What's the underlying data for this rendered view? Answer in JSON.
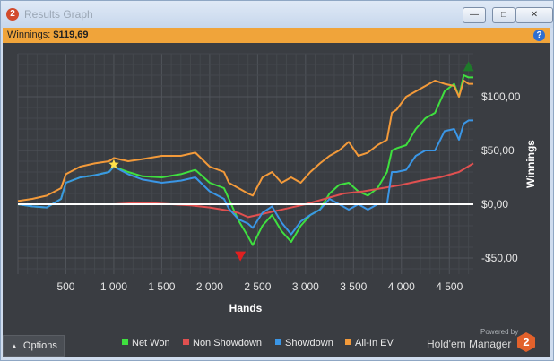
{
  "window": {
    "title": "Results Graph",
    "app_icon": "hm2-logo-icon",
    "controls": [
      "minimize-icon",
      "maximize-icon",
      "close-icon"
    ]
  },
  "winnings_bar": {
    "label": "Winnings:",
    "value": "$119,69",
    "help_icon": "help-icon"
  },
  "colors": {
    "net_won": "#3fe03f",
    "non_showdown": "#e05050",
    "showdown": "#3a96e6",
    "all_in_ev": "#f39a3a",
    "zero_line": "#ffffff",
    "plot_background": "#3a3d42",
    "grid": "#55595e"
  },
  "options": {
    "label": "Options",
    "icon": "caret-up-icon"
  },
  "branding": {
    "powered": "Powered by",
    "name": "Hold'em Manager",
    "logo": "hm2-logo-icon"
  },
  "chart_data": {
    "type": "line",
    "xlabel": "Hands",
    "ylabel": "Winnings",
    "xlim": [
      0,
      4750
    ],
    "ylim": [
      -65,
      140
    ],
    "x_ticks": [
      500,
      1000,
      1500,
      2000,
      2500,
      3000,
      3500,
      4000,
      4500
    ],
    "x_tick_labels": [
      "500",
      "1 000",
      "1 500",
      "2 000",
      "2 500",
      "3 000",
      "3 500",
      "4 000",
      "4 500"
    ],
    "y_ticks": [
      -50,
      0,
      50,
      100
    ],
    "y_tick_labels": [
      "-$50,00",
      "$0,00",
      "$50,00",
      "$100,00"
    ],
    "grid": true,
    "legend_position": "bottom",
    "markers": [
      {
        "type": "max-star",
        "series": "Net Won",
        "x": 1000,
        "y": 37
      },
      {
        "type": "min-triangle",
        "series": "Net Won",
        "x": 2320,
        "y": -48
      },
      {
        "type": "end-triangle",
        "series": "Net Won",
        "x": 4700,
        "y": 128
      }
    ],
    "series": [
      {
        "name": "Net Won",
        "color": "#3fe03f",
        "x": [
          0,
          150,
          300,
          450,
          500,
          650,
          800,
          950,
          1000,
          1150,
          1300,
          1500,
          1700,
          1850,
          2000,
          2150,
          2200,
          2300,
          2400,
          2450,
          2550,
          2650,
          2750,
          2850,
          2950,
          3050,
          3150,
          3250,
          3350,
          3450,
          3550,
          3650,
          3750,
          3850,
          3900,
          3950,
          4050,
          4150,
          4250,
          4350,
          4450,
          4550,
          4600,
          4650,
          4700,
          4750
        ],
        "y": [
          0,
          -2,
          -3,
          5,
          20,
          25,
          27,
          30,
          35,
          30,
          26,
          25,
          28,
          32,
          20,
          15,
          5,
          -15,
          -30,
          -38,
          -20,
          -10,
          -25,
          -35,
          -20,
          -10,
          -5,
          10,
          18,
          20,
          12,
          8,
          15,
          30,
          50,
          52,
          55,
          70,
          80,
          85,
          105,
          112,
          100,
          120,
          118,
          118
        ]
      },
      {
        "name": "Non Showdown",
        "color": "#e05050",
        "x": [
          0,
          200,
          400,
          600,
          800,
          1000,
          1200,
          1400,
          1600,
          1800,
          2000,
          2200,
          2300,
          2400,
          2600,
          2800,
          3000,
          3200,
          3400,
          3600,
          3800,
          4000,
          4200,
          4400,
          4600,
          4750
        ],
        "y": [
          0,
          0,
          0,
          0,
          0,
          0,
          1,
          1,
          0,
          -1,
          -3,
          -6,
          -8,
          -12,
          -8,
          -4,
          0,
          5,
          10,
          12,
          15,
          18,
          22,
          25,
          30,
          38
        ]
      },
      {
        "name": "Showdown",
        "color": "#3a96e6",
        "x": [
          0,
          150,
          300,
          450,
          500,
          650,
          800,
          950,
          1000,
          1150,
          1300,
          1500,
          1700,
          1850,
          2000,
          2150,
          2200,
          2300,
          2400,
          2450,
          2550,
          2650,
          2750,
          2850,
          2950,
          3050,
          3150,
          3250,
          3350,
          3450,
          3550,
          3650,
          3750,
          3850,
          3900,
          3950,
          4050,
          4150,
          4250,
          4350,
          4450,
          4550,
          4600,
          4650,
          4700,
          4750
        ],
        "y": [
          0,
          -2,
          -3,
          5,
          20,
          25,
          27,
          30,
          35,
          28,
          23,
          20,
          22,
          25,
          12,
          5,
          -4,
          -14,
          -18,
          -22,
          -8,
          -2,
          -17,
          -28,
          -16,
          -10,
          -5,
          5,
          0,
          -5,
          0,
          -5,
          0,
          0,
          30,
          30,
          32,
          45,
          50,
          50,
          68,
          70,
          60,
          75,
          78,
          78
        ]
      },
      {
        "name": "All-In EV",
        "color": "#f39a3a",
        "x": [
          0,
          150,
          300,
          450,
          500,
          650,
          800,
          950,
          1000,
          1150,
          1300,
          1500,
          1700,
          1850,
          2000,
          2150,
          2200,
          2300,
          2400,
          2450,
          2550,
          2650,
          2750,
          2850,
          2950,
          3050,
          3150,
          3250,
          3350,
          3450,
          3550,
          3650,
          3750,
          3850,
          3900,
          3950,
          4050,
          4150,
          4250,
          4350,
          4450,
          4550,
          4600,
          4650,
          4700,
          4750
        ],
        "y": [
          3,
          5,
          8,
          15,
          28,
          35,
          38,
          40,
          43,
          40,
          42,
          45,
          45,
          48,
          35,
          30,
          20,
          15,
          10,
          8,
          25,
          30,
          20,
          25,
          20,
          30,
          38,
          45,
          50,
          58,
          45,
          48,
          55,
          60,
          85,
          88,
          100,
          105,
          110,
          115,
          112,
          110,
          100,
          115,
          112,
          112
        ]
      }
    ]
  }
}
